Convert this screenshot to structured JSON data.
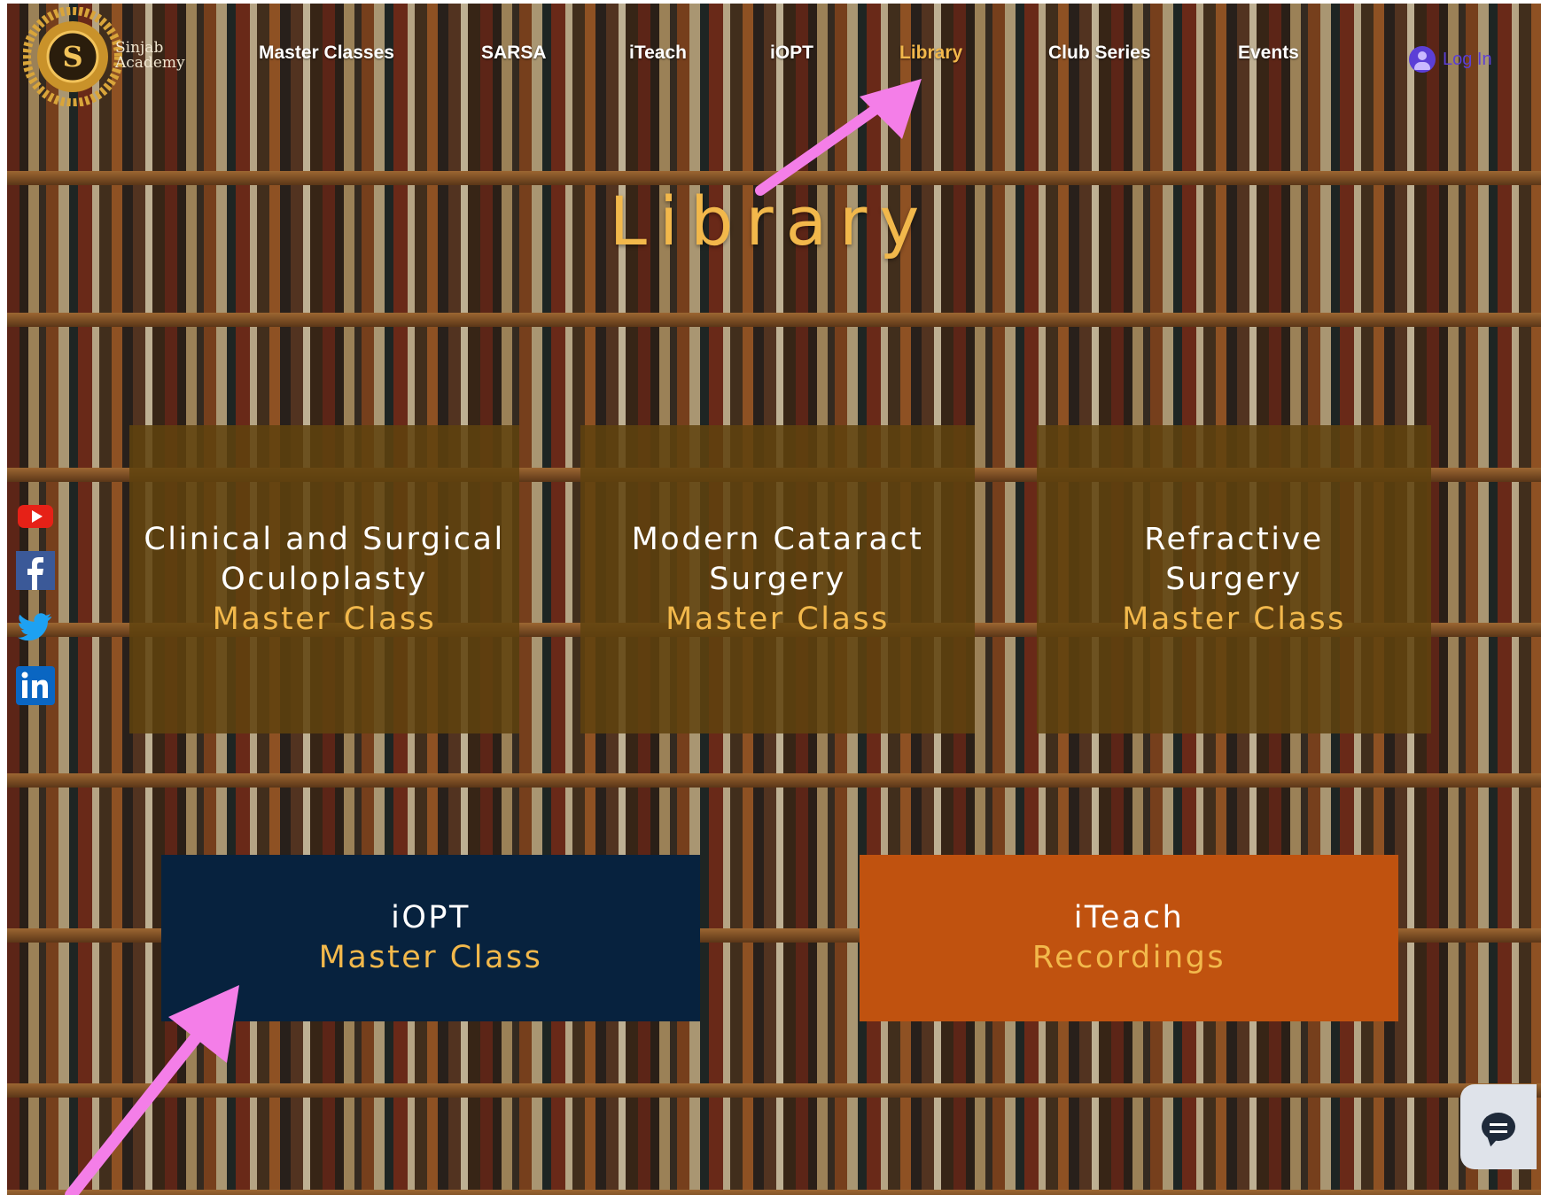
{
  "brand": {
    "name_line1": "Sinjab",
    "name_line2": "Academy",
    "logo_letter": "S"
  },
  "nav": {
    "items": [
      "Master Classes",
      "SARSA",
      "iTeach",
      "iOPT",
      "Library",
      "Club Series",
      "Events"
    ],
    "active": "Library",
    "login_label": "Log In"
  },
  "page_title": "Library",
  "cards": [
    {
      "title": "Clinical and Surgical Oculoplasty",
      "subtitle": "Master Class"
    },
    {
      "title": "Modern Cataract Surgery",
      "subtitle": "Master Class"
    },
    {
      "title": "Refractive Surgery",
      "subtitle": "Master Class"
    }
  ],
  "bottom_cards": [
    {
      "title": "iOPT",
      "subtitle": "Master Class",
      "color": "#07223e"
    },
    {
      "title": "iTeach",
      "subtitle": "Recordings",
      "color": "#c0520f"
    }
  ],
  "social": [
    "youtube-icon",
    "facebook-icon",
    "twitter-icon",
    "linkedin-icon"
  ],
  "colors": {
    "accent": "#f2b84b",
    "annotation_arrow": "#f47ee8",
    "login": "#5b3fd6"
  }
}
